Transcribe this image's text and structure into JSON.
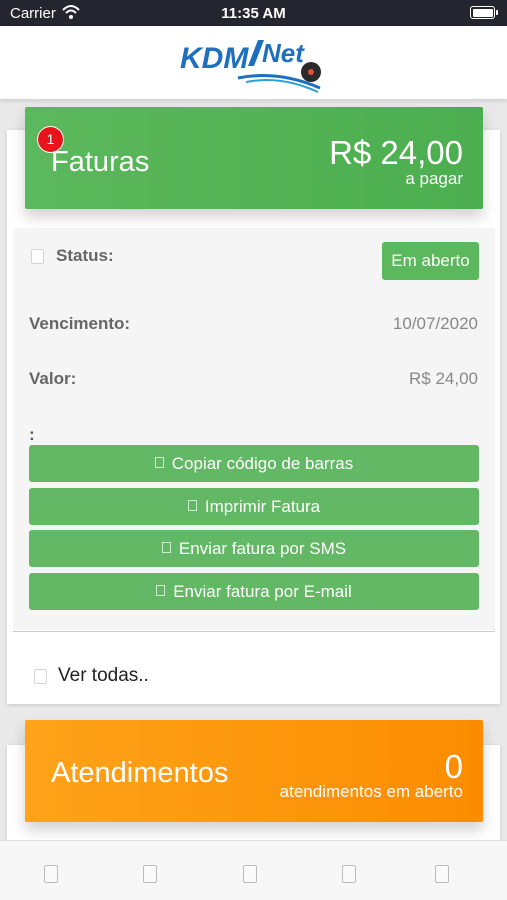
{
  "status_bar": {
    "carrier": "Carrier",
    "time": "11:35 AM"
  },
  "header": {
    "logo_icon": "kdmnet-telecom-logo",
    "logo_text": "KDMNet"
  },
  "faturas": {
    "title": "Faturas",
    "badge": "1",
    "amount": "R$ 24,00",
    "amount_sub": "a pagar",
    "accent": "#5cb85c",
    "details": {
      "status_label": "Status:",
      "status_value": "Em aberto",
      "vencimento_label": "Vencimento:",
      "vencimento_value": "10/07/2020",
      "valor_label": "Valor:",
      "valor_value": "R$ 24,00",
      "colon": ":"
    },
    "buttons": [
      {
        "label": "Copiar código de barras"
      },
      {
        "label": "Imprimir Fatura"
      },
      {
        "label": "Enviar fatura por SMS"
      },
      {
        "label": "Enviar fatura por E-mail"
      }
    ],
    "ver_todas": "Ver todas.."
  },
  "atendimentos": {
    "title": "Atendimentos",
    "count": "0",
    "count_sub": "atendimentos em aberto",
    "accent": "#fb8c00"
  },
  "tabbar": {
    "tabs": [
      "tab-1",
      "tab-2",
      "tab-3",
      "tab-4",
      "tab-5"
    ]
  }
}
